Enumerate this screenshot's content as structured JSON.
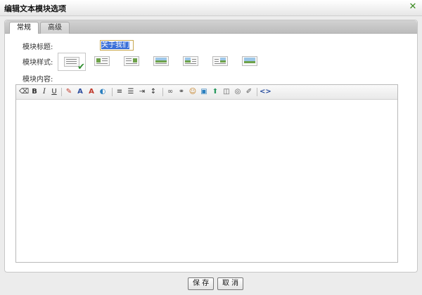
{
  "dialog": {
    "title": "编辑文本模块选项",
    "close_glyph": "✕"
  },
  "tabs": [
    {
      "label": "常规",
      "active": true
    },
    {
      "label": "高级",
      "active": false
    }
  ],
  "form": {
    "title_label": "模块标题:",
    "title_value": "关于我们",
    "style_label": "模块样式:",
    "content_label": "模块内容:",
    "styles_count": 7,
    "selected_style_index": 0
  },
  "toolbar_icons": [
    "eraser-icon",
    "bold-icon",
    "italic-icon",
    "underline-icon",
    "spellcheck-icon",
    "font-size-icon",
    "font-color-icon",
    "highlight-color-icon",
    "align-left-icon",
    "bullet-list-icon",
    "indent-icon",
    "line-spacing-icon",
    "link-icon",
    "unlink-icon",
    "emoticon-icon",
    "insert-image-icon",
    "image-up-icon",
    "flash-icon",
    "media-icon",
    "edit-icon",
    "source-code-icon"
  ],
  "buttons": {
    "save": "保 存",
    "cancel": "取 消"
  },
  "colors": {
    "accent_green": "#3a8a1f",
    "selection_blue": "#3a6fd8"
  }
}
